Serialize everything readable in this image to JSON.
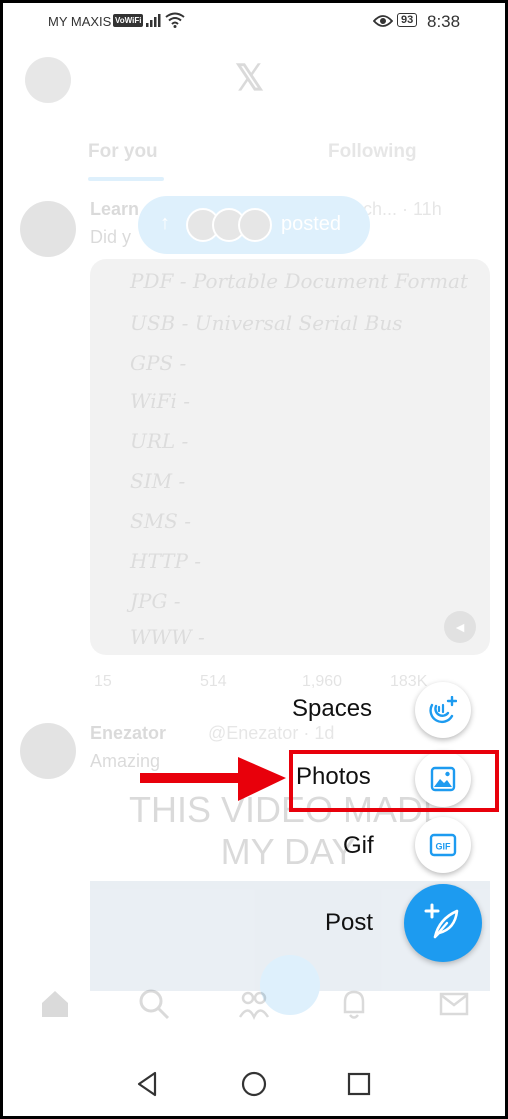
{
  "status_bar": {
    "carrier": "MY MAXIS",
    "vowifi": "VoWiFi",
    "battery": "93",
    "time": "8:38"
  },
  "header": {
    "logo": "𝕏",
    "tabs": [
      {
        "label": "For you",
        "active": true
      },
      {
        "label": "Following",
        "active": false
      }
    ]
  },
  "banner": {
    "label": "posted"
  },
  "post1": {
    "name": "Learn",
    "meta": "ch... · 11h",
    "text": "Did y",
    "media_lines": [
      "PDF - Portable Document Format",
      "USB - Universal Serial Bus",
      "GPS -",
      "WiFi -",
      "URL -",
      "SIM -",
      "SMS -",
      "HTTP -",
      "JPG -",
      "WWW -"
    ],
    "actions": {
      "replies": "15",
      "reposts": "514",
      "likes": "1,960",
      "views": "183K"
    }
  },
  "post2": {
    "name": "Enezator",
    "handle": "@Enezator · 1d",
    "text": "Amazing",
    "video_caption": "THIS VIDEO MADE MY DAY"
  },
  "fab_menu": {
    "items": [
      {
        "label": "Spaces",
        "icon": "spaces-icon"
      },
      {
        "label": "Photos",
        "icon": "photos-icon"
      },
      {
        "label": "Gif",
        "icon": "gif-icon"
      }
    ],
    "post_label": "Post",
    "gif_badge": "GIF"
  },
  "colors": {
    "accent": "#1d9bf0",
    "annotation_red": "#e8000b"
  }
}
